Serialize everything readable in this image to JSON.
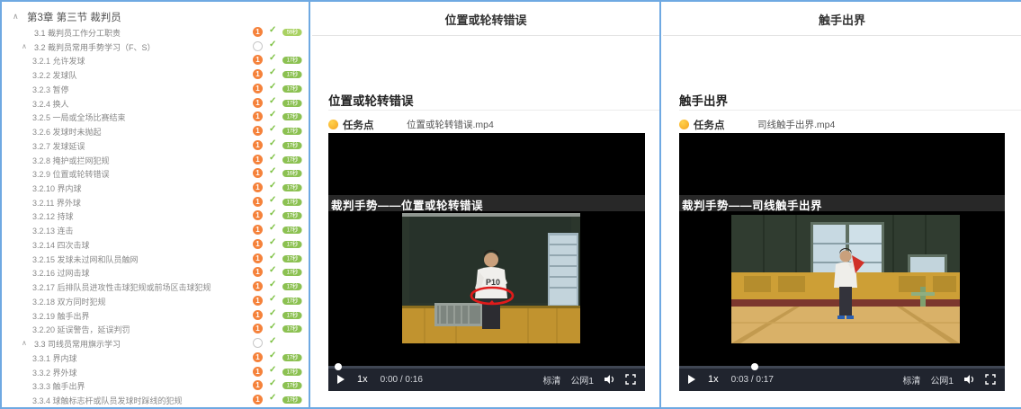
{
  "colors": {
    "accent_border": "#6fa9e2",
    "task_orange": "#f5823b",
    "check_green": "#7dc142",
    "badge_green": "#8cc152"
  },
  "sidebar": {
    "chapter": {
      "label": "第3章 第三节 裁判员",
      "caret": "∧"
    },
    "items": [
      {
        "label": "3.1 裁判员工作分工职责",
        "level": 1,
        "has_children": false,
        "count": "1",
        "check": true,
        "badge": "59秒",
        "badge_light": true
      },
      {
        "label": "3.2 裁判员常用手势学习（F、S）",
        "level": 1,
        "has_children": true,
        "count": "",
        "check": true,
        "badge": ""
      },
      {
        "label": "3.2.1 允许发球",
        "level": 2,
        "has_children": false,
        "count": "1",
        "check": true,
        "badge": "17秒"
      },
      {
        "label": "3.2.2 发球队",
        "level": 2,
        "has_children": false,
        "count": "1",
        "check": true,
        "badge": "17秒"
      },
      {
        "label": "3.2.3 暂停",
        "level": 2,
        "has_children": false,
        "count": "1",
        "check": true,
        "badge": "17秒"
      },
      {
        "label": "3.2.4 换人",
        "level": 2,
        "has_children": false,
        "count": "1",
        "check": true,
        "badge": "17秒"
      },
      {
        "label": "3.2.5 一局或全场比赛结束",
        "level": 2,
        "has_children": false,
        "count": "1",
        "check": true,
        "badge": "17秒"
      },
      {
        "label": "3.2.6 发球时未抛起",
        "level": 2,
        "has_children": false,
        "count": "1",
        "check": true,
        "badge": "17秒"
      },
      {
        "label": "3.2.7 发球延误",
        "level": 2,
        "has_children": false,
        "count": "1",
        "check": true,
        "badge": "17秒"
      },
      {
        "label": "3.2.8 掩护或拦网犯规",
        "level": 2,
        "has_children": false,
        "count": "1",
        "check": true,
        "badge": "17秒"
      },
      {
        "label": "3.2.9 位置或轮转错误",
        "level": 2,
        "has_children": false,
        "count": "1",
        "check": true,
        "badge": "16秒"
      },
      {
        "label": "3.2.10 界内球",
        "level": 2,
        "has_children": false,
        "count": "1",
        "check": true,
        "badge": "17秒"
      },
      {
        "label": "3.2.11 界外球",
        "level": 2,
        "has_children": false,
        "count": "1",
        "check": true,
        "badge": "17秒"
      },
      {
        "label": "3.2.12 持球",
        "level": 2,
        "has_children": false,
        "count": "1",
        "check": true,
        "badge": "17秒"
      },
      {
        "label": "3.2.13 连击",
        "level": 2,
        "has_children": false,
        "count": "1",
        "check": true,
        "badge": "17秒"
      },
      {
        "label": "3.2.14 四次击球",
        "level": 2,
        "has_children": false,
        "count": "1",
        "check": true,
        "badge": "17秒"
      },
      {
        "label": "3.2.15 发球未过网和队员触网",
        "level": 2,
        "has_children": false,
        "count": "1",
        "check": true,
        "badge": "17秒"
      },
      {
        "label": "3.2.16 过网击球",
        "level": 2,
        "has_children": false,
        "count": "1",
        "check": true,
        "badge": "17秒"
      },
      {
        "label": "3.2.17 后排队员进攻性击球犯规或前场区击球犯规",
        "level": 2,
        "has_children": false,
        "count": "1",
        "check": true,
        "badge": "17秒"
      },
      {
        "label": "3.2.18 双方同时犯规",
        "level": 2,
        "has_children": false,
        "count": "1",
        "check": true,
        "badge": "17秒"
      },
      {
        "label": "3.2.19 触手出界",
        "level": 2,
        "has_children": false,
        "count": "1",
        "check": true,
        "badge": "17秒"
      },
      {
        "label": "3.2.20 延误警告，延误判罚",
        "level": 2,
        "has_children": false,
        "count": "1",
        "check": true,
        "badge": "17秒"
      },
      {
        "label": "3.3 司线员常用旗示学习",
        "level": 1,
        "has_children": true,
        "count": "",
        "check": true,
        "badge": ""
      },
      {
        "label": "3.3.1 界内球",
        "level": 2,
        "has_children": false,
        "count": "1",
        "check": true,
        "badge": "17秒"
      },
      {
        "label": "3.3.2 界外球",
        "level": 2,
        "has_children": false,
        "count": "1",
        "check": true,
        "badge": "17秒"
      },
      {
        "label": "3.3.3 触手出界",
        "level": 2,
        "has_children": false,
        "count": "1",
        "check": true,
        "badge": "17秒"
      },
      {
        "label": "3.3.4 球触标志杆或队员发球时踩线的犯规",
        "level": 2,
        "has_children": false,
        "count": "1",
        "check": true,
        "badge": "17秒"
      }
    ]
  },
  "panels": [
    {
      "title": "位置或轮转错误",
      "section_heading": "位置或轮转错误",
      "task_label": "任务点",
      "file_name": "位置或轮转错误.mp4",
      "video": {
        "overlay_text": "裁判手势——位置或轮转错误",
        "speed": "1x",
        "time": "0:00 / 0:16",
        "quality": "标清",
        "network": "公网1",
        "progress_percent": 2
      }
    },
    {
      "title": "触手出界",
      "section_heading": "触手出界",
      "task_label": "任务点",
      "file_name": "司线触手出界.mp4",
      "video": {
        "overlay_text": "裁判手势——司线触手出界",
        "speed": "1x",
        "time": "0:03 / 0:17",
        "quality": "标清",
        "network": "公网1",
        "progress_percent": 22
      }
    }
  ]
}
